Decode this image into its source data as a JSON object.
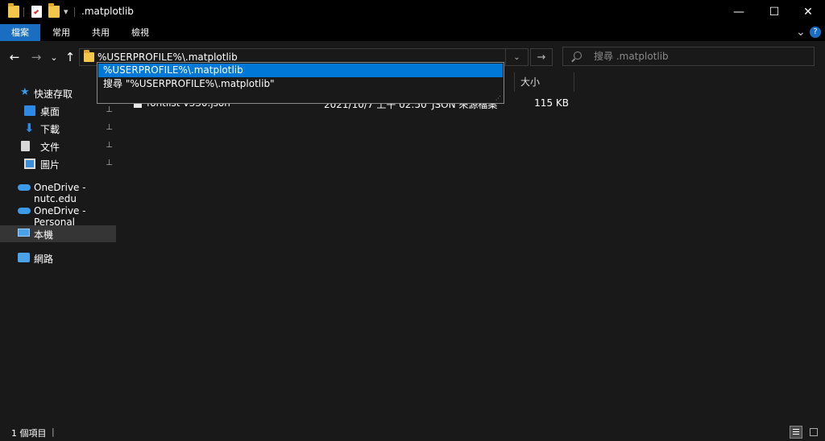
{
  "window": {
    "title": ".matplotlib",
    "minimize_glyph": "—",
    "maximize_glyph": "☐",
    "close_glyph": "✕",
    "quick_access_dropdown_glyph": "▾"
  },
  "ribbon": {
    "tabs": [
      "檔案",
      "常用",
      "共用",
      "檢視"
    ],
    "expand_glyph": "⌄",
    "help_glyph": "?"
  },
  "nav": {
    "back_glyph": "←",
    "forward_glyph": "→",
    "recent_glyph": "⌄",
    "up_glyph": "↑"
  },
  "address": {
    "value": "%USERPROFILE%\\.matplotlib",
    "dropdown_glyph": "⌄",
    "go_glyph": "→"
  },
  "search": {
    "placeholder": "搜尋 .matplotlib",
    "icon": "search-icon"
  },
  "autocomplete": {
    "items": [
      "%USERPROFILE%\\.matplotlib",
      "搜尋 \"%USERPROFILE%\\.matplotlib\""
    ],
    "selected_index": 0
  },
  "sidebar": {
    "items": [
      {
        "label": "快速存取",
        "icon": "star-icon"
      },
      {
        "label": "桌面",
        "icon": "desktop-icon",
        "pinned": true
      },
      {
        "label": "下載",
        "icon": "download-icon",
        "pinned": true
      },
      {
        "label": "文件",
        "icon": "documents-icon",
        "pinned": true
      },
      {
        "label": "圖片",
        "icon": "pictures-icon",
        "pinned": true
      },
      {
        "label": "OneDrive - nutc.edu",
        "icon": "cloud-icon"
      },
      {
        "label": "OneDrive - Personal",
        "icon": "cloud-icon"
      },
      {
        "label": "本機",
        "icon": "computer-icon"
      },
      {
        "label": "網路",
        "icon": "network-icon"
      }
    ],
    "pin_glyph": "📌"
  },
  "content": {
    "columns": {
      "size": "大小"
    },
    "rows": [
      {
        "name": "fontlist-v330.json",
        "date": "2021/10/7 上午 02:50",
        "type": "JSON 來源檔案",
        "size": "115 KB"
      }
    ]
  },
  "status": {
    "item_count": "1 個項目",
    "separator": "|"
  },
  "colors": {
    "accent": "#1a6ec2",
    "selection": "#0078d7",
    "background": "#191919"
  }
}
